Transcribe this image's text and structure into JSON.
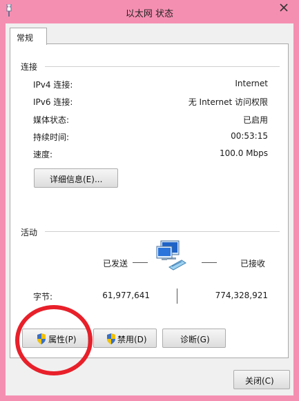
{
  "window": {
    "title": "以太网 状态"
  },
  "tabs": [
    {
      "label": "常规"
    }
  ],
  "connection": {
    "section_label": "连接",
    "rows": [
      {
        "label": "IPv4 连接:",
        "value": "Internet"
      },
      {
        "label": "IPv6 连接:",
        "value": "无 Internet 访问权限"
      },
      {
        "label": "媒体状态:",
        "value": "已启用"
      },
      {
        "label": "持续时间:",
        "value": "00:53:15"
      },
      {
        "label": "速度:",
        "value": "100.0 Mbps"
      }
    ],
    "details_button": "详细信息(E)..."
  },
  "activity": {
    "section_label": "活动",
    "sent_label": "已发送",
    "received_label": "已接收",
    "bytes_label": "字节:",
    "bytes_sent": "61,977,641",
    "bytes_received": "774,328,921"
  },
  "buttons": {
    "properties": "属性(P)",
    "disable": "禁用(D)",
    "diagnose": "诊断(G)",
    "close": "关闭(C)"
  },
  "icons": {
    "app": "network-connection-icon",
    "activity": "network-computers-icon",
    "shield": "uac-shield-icon"
  },
  "colors": {
    "frame": "#f58fb1",
    "annotation": "#e8202a"
  }
}
